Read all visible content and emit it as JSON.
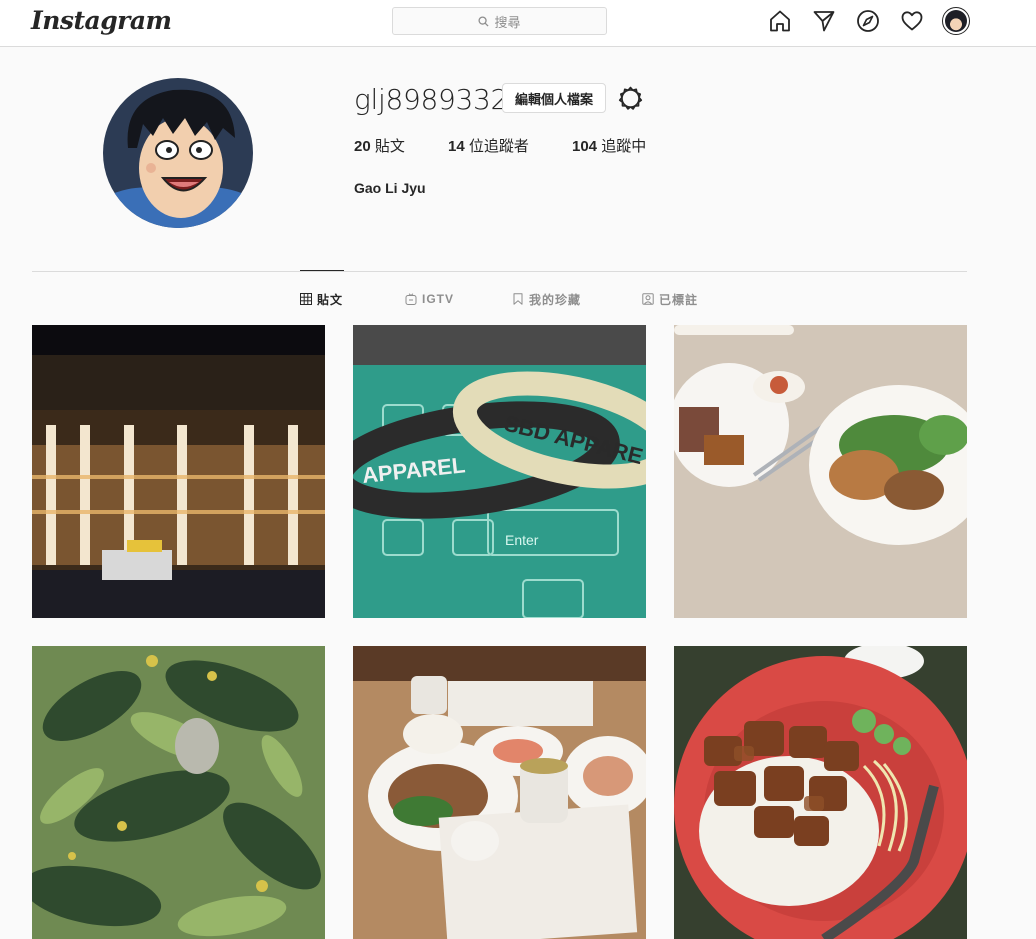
{
  "nav": {
    "logo": "Instagram",
    "search_placeholder": "搜尋",
    "icons": [
      "home-icon",
      "direct-icon",
      "explore-icon",
      "activity-icon",
      "profile-avatar"
    ]
  },
  "profile": {
    "username": "glj8989332",
    "edit_button": "編輯個人檔案",
    "stats": {
      "posts_count": "20",
      "posts_label": "貼文",
      "followers_count": "14",
      "followers_label": "位追蹤者",
      "following_count": "104",
      "following_label": "追蹤中"
    },
    "full_name": "Gao Li Jyu"
  },
  "tabs": [
    {
      "label": "貼文",
      "icon": "grid-icon",
      "active": true
    },
    {
      "label": "IGTV",
      "icon": "igtv-icon",
      "active": false
    },
    {
      "label": "我的珍藏",
      "icon": "bookmark-icon",
      "active": false
    },
    {
      "label": "已標註",
      "icon": "tagged-icon",
      "active": false
    }
  ],
  "posts": [
    {
      "subject": "night-building"
    },
    {
      "subject": "wristbands-keyboard"
    },
    {
      "subject": "food-plate"
    },
    {
      "subject": "leaves"
    },
    {
      "subject": "buffet-table"
    },
    {
      "subject": "braised-pork-rice"
    }
  ],
  "colors": {
    "background": "#fafafa",
    "border": "#dbdbdb",
    "text": "#262626",
    "muted": "#8e8e8e"
  }
}
